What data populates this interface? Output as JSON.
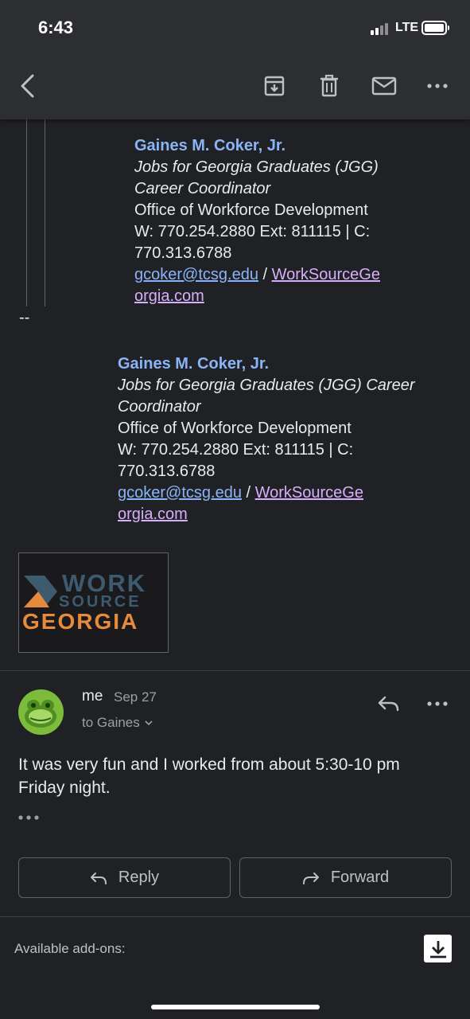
{
  "status_bar": {
    "time": "6:43",
    "network": "LTE"
  },
  "toolbar": {
    "ghost_text_1": "",
    "ghost_text_2": ""
  },
  "quoted_signature": {
    "name": "Gaines M. Coker, Jr.",
    "title_line_1": "Jobs for Georgia Graduates (JGG)",
    "title_line_2": "Career Coordinator",
    "office": "Office of Workforce Development",
    "phone_line_1": "W: 770.254.2880 Ext: 811115 | C:",
    "phone_line_2": "770.313.6788",
    "email": "gcoker@tcsg.edu",
    "separator": " / ",
    "website_line_1": "WorkSourceGe",
    "website_line_2": "orgia.com"
  },
  "sig_delimiter": "--",
  "signature": {
    "name": "Gaines M. Coker, Jr.",
    "title_line_1": "Jobs for Georgia Graduates (JGG) Career",
    "title_line_2": "Coordinator",
    "office": "Office of Workforce Development",
    "phone_line_1": "W: 770.254.2880 Ext: 811115 | C:",
    "phone_line_2": "770.313.6788",
    "email": "gcoker@tcsg.edu",
    "separator": " / ",
    "website_line_1": "WorkSourceGe",
    "website_line_2": "orgia.com"
  },
  "logo": {
    "work": "WORK",
    "source": "SOURCE",
    "georgia": "GEORGIA"
  },
  "message": {
    "sender": "me",
    "date": "Sep 27",
    "recipient": "to Gaines",
    "body": "It was very fun and I worked from about 5:30-10 pm Friday night."
  },
  "actions": {
    "reply_label": "Reply",
    "forward_label": "Forward"
  },
  "addons": {
    "label": "Available add-ons:"
  },
  "colors": {
    "background": "#202124",
    "toolbar": "#2d2e31",
    "link_blue": "#8ab4f8",
    "link_purple": "#d7aefb",
    "logo_orange": "#e78a3c",
    "logo_slate": "#3e5a6f"
  },
  "icons": {
    "back": "arrow-back-icon",
    "archive": "archive-icon",
    "delete": "trash-icon",
    "mark_unread": "mail-icon",
    "more": "more-horiz-icon",
    "reply": "reply-icon",
    "forward": "forward-icon",
    "download": "download-icon",
    "chevron": "chevron-down-icon"
  }
}
